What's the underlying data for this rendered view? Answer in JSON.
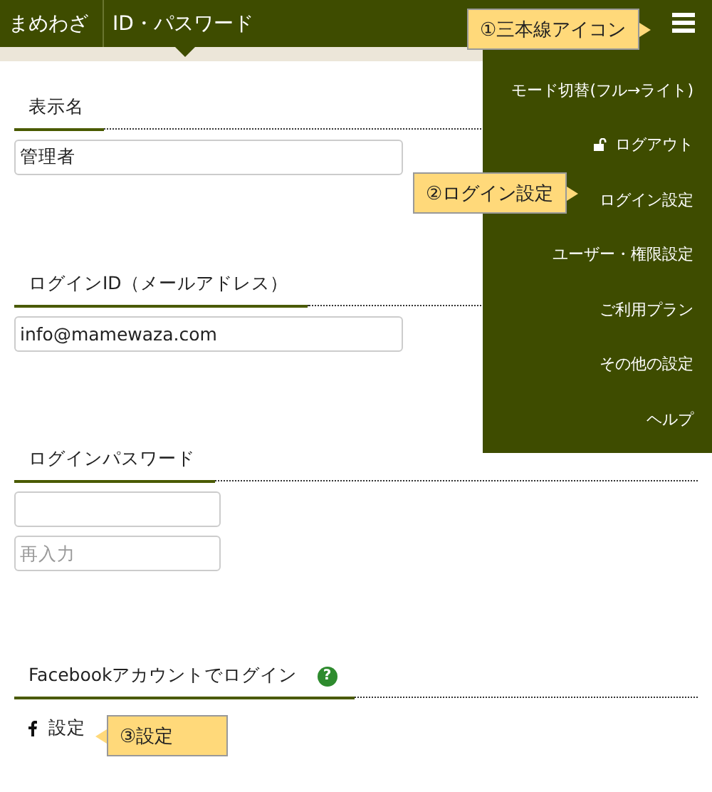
{
  "header": {
    "breadcrumbs": [
      {
        "label": "まめわざ",
        "selected": false
      },
      {
        "label": "ID・パスワード",
        "selected": true
      }
    ]
  },
  "menu": {
    "items": [
      {
        "label": "モード切替(フル→ライト)",
        "kind": "text"
      },
      {
        "label": "ログアウト",
        "kind": "lock"
      },
      {
        "label": "ログイン設定",
        "kind": "text"
      },
      {
        "label": "ユーザー・権限設定",
        "kind": "text"
      },
      {
        "label": "ご利用プラン",
        "kind": "text"
      },
      {
        "label": "その他の設定",
        "kind": "text"
      },
      {
        "label": "ヘルプ",
        "kind": "text"
      }
    ]
  },
  "sections": [
    {
      "heading": "表示名",
      "kind": "fields",
      "fields": [
        {
          "kind": "text",
          "value": "管理者"
        }
      ]
    },
    {
      "heading": "ログインID（メールアドレス）",
      "kind": "fields",
      "fields": [
        {
          "kind": "text",
          "value": "info@mamewaza.com"
        }
      ]
    },
    {
      "heading": "ログインパスワード",
      "kind": "fields",
      "fields": [
        {
          "kind": "password"
        },
        {
          "kind": "password",
          "placeholder": "再入力"
        }
      ]
    },
    {
      "heading": "Facebookアカウントでログイン",
      "kind": "facebook",
      "help": "?",
      "link": "設定"
    }
  ],
  "callouts": [
    {
      "text": "①三本線アイコン",
      "kind": "right"
    },
    {
      "text": "②ログイン設定",
      "kind": "right"
    },
    {
      "text": "③設定",
      "kind": "left"
    }
  ]
}
